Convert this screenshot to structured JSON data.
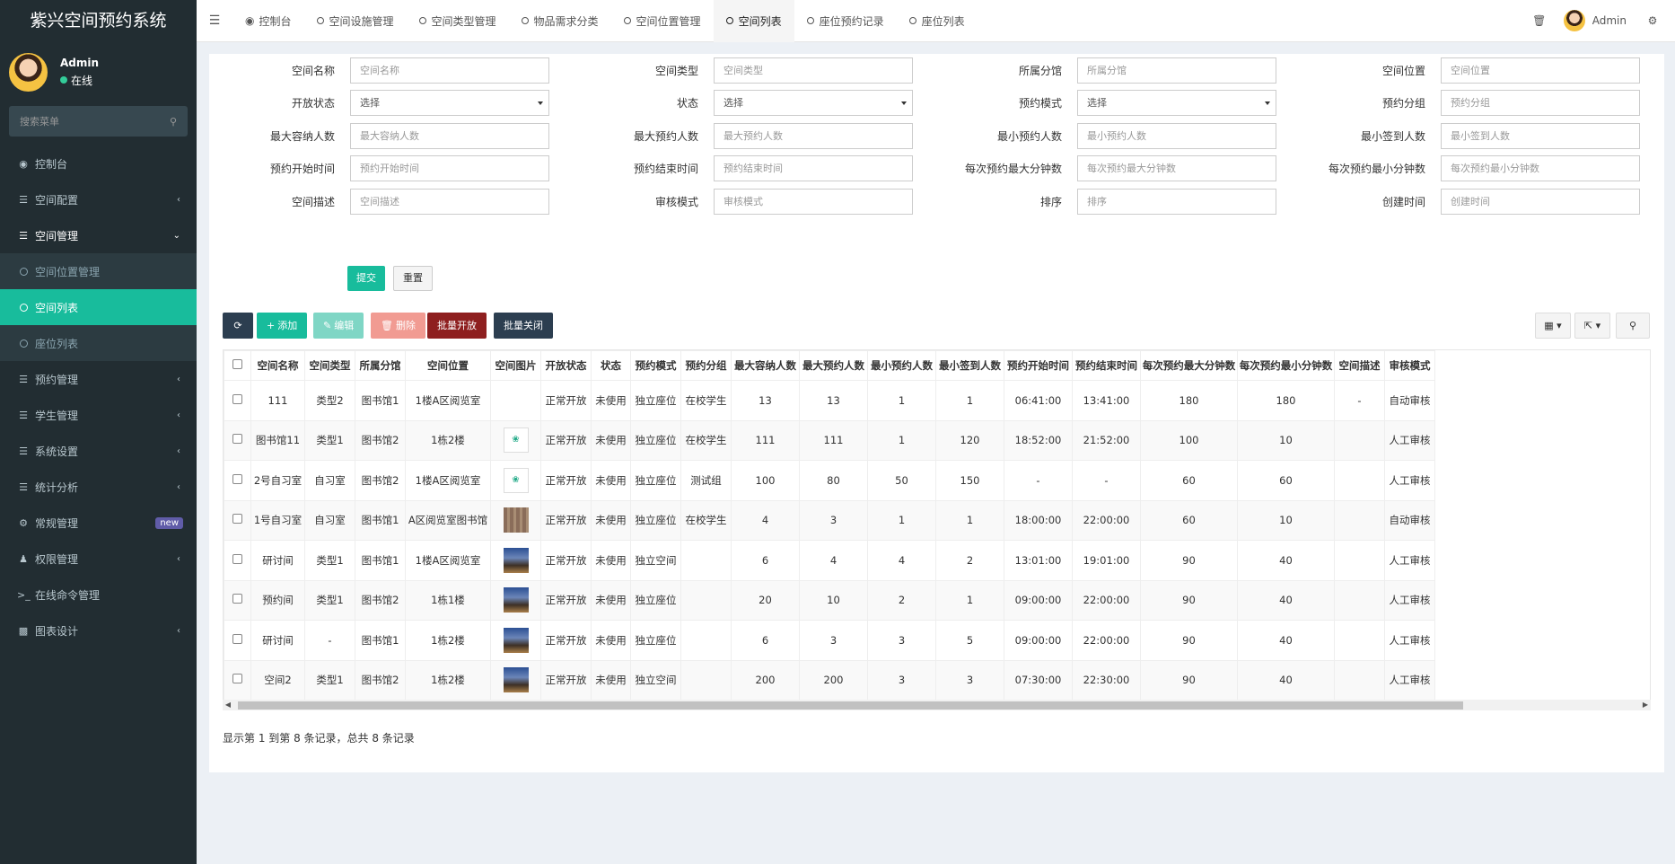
{
  "app": {
    "title": "紫兴空间预约系统"
  },
  "user": {
    "name": "Admin",
    "status": "在线"
  },
  "sidebar": {
    "search_placeholder": "搜索菜单",
    "items": [
      {
        "label": "控制台",
        "icon": "dashboard-icon"
      },
      {
        "label": "空间配置",
        "icon": "list-icon",
        "arrow": "‹"
      },
      {
        "label": "空间管理",
        "icon": "list-icon",
        "arrow": "⌄"
      },
      {
        "label": "预约管理",
        "icon": "list-icon",
        "arrow": "‹"
      },
      {
        "label": "学生管理",
        "icon": "list-icon",
        "arrow": "‹"
      },
      {
        "label": "系统设置",
        "icon": "list-icon",
        "arrow": "‹"
      },
      {
        "label": "统计分析",
        "icon": "list-icon",
        "arrow": "‹"
      },
      {
        "label": "常规管理",
        "icon": "cogs-icon",
        "badge": "new"
      },
      {
        "label": "权限管理",
        "icon": "group-icon",
        "arrow": "‹"
      },
      {
        "label": "在线命令管理",
        "icon": "terminal-icon"
      },
      {
        "label": "图表设计",
        "icon": "bar-chart-icon",
        "arrow": "‹"
      }
    ],
    "subitems": [
      {
        "label": "空间位置管理"
      },
      {
        "label": "空间列表"
      },
      {
        "label": "座位列表"
      }
    ]
  },
  "topnav": {
    "tabs": [
      "控制台",
      "空间设施管理",
      "空间类型管理",
      "物品需求分类",
      "空间位置管理",
      "空间列表",
      "座位预约记录",
      "座位列表"
    ],
    "user_name": "Admin"
  },
  "filters": {
    "rows": [
      [
        {
          "label": "空间名称",
          "placeholder": "空间名称"
        },
        {
          "label": "空间类型",
          "placeholder": "空间类型"
        },
        {
          "label": "所属分馆",
          "placeholder": "所属分馆"
        },
        {
          "label": "空间位置",
          "placeholder": "空间位置"
        }
      ],
      [
        {
          "label": "开放状态",
          "placeholder": "选择",
          "select": true
        },
        {
          "label": "状态",
          "placeholder": "选择",
          "select": true
        },
        {
          "label": "预约模式",
          "placeholder": "选择",
          "select": true
        },
        {
          "label": "预约分组",
          "placeholder": "预约分组"
        }
      ],
      [
        {
          "label": "最大容纳人数",
          "placeholder": "最大容纳人数"
        },
        {
          "label": "最大预约人数",
          "placeholder": "最大预约人数"
        },
        {
          "label": "最小预约人数",
          "placeholder": "最小预约人数"
        },
        {
          "label": "最小签到人数",
          "placeholder": "最小签到人数"
        }
      ],
      [
        {
          "label": "预约开始时间",
          "placeholder": "预约开始时间"
        },
        {
          "label": "预约结束时间",
          "placeholder": "预约结束时间"
        },
        {
          "label": "每次预约最大分钟数",
          "placeholder": "每次预约最大分钟数"
        },
        {
          "label": "每次预约最小分钟数",
          "placeholder": "每次预约最小分钟数"
        }
      ],
      [
        {
          "label": "空间描述",
          "placeholder": "空间描述"
        },
        {
          "label": "审核模式",
          "placeholder": "审核模式"
        },
        {
          "label": "排序",
          "placeholder": "排序"
        },
        {
          "label": "创建时间",
          "placeholder": "创建时间"
        }
      ]
    ],
    "submit_label": "提交",
    "reset_label": "重置"
  },
  "toolbar": {
    "add_label": "添加",
    "edit_label": "编辑",
    "delete_label": "删除",
    "batch_open_label": "批量开放",
    "batch_close_label": "批量关闭"
  },
  "table": {
    "columns": [
      "空间名称",
      "空间类型",
      "所属分馆",
      "空间位置",
      "空间图片",
      "开放状态",
      "状态",
      "预约模式",
      "预约分组",
      "最大容纳人数",
      "最大预约人数",
      "最小预约人数",
      "最小签到人数",
      "预约开始时间",
      "预约结束时间",
      "每次预约最大分钟数",
      "每次预约最小分钟数",
      "空间描述",
      "审核模式"
    ],
    "rows": [
      {
        "name": "111",
        "type": "类型2",
        "branch": "图书馆1",
        "location": "1楼A区阅览室",
        "image": "",
        "open": "正常开放",
        "status": "未使用",
        "mode": "独立座位",
        "group": "在校学生",
        "max_cap": "13",
        "max_res": "13",
        "min_res": "1",
        "min_sign": "1",
        "start": "06:41:00",
        "end": "13:41:00",
        "max_min": "180",
        "min_min": "180",
        "desc": "-",
        "audit": "自动审核"
      },
      {
        "name": "图书馆11",
        "type": "类型1",
        "branch": "图书馆2",
        "location": "1栋2楼",
        "image": "icon",
        "open": "正常开放",
        "status": "未使用",
        "mode": "独立座位",
        "group": "在校学生",
        "max_cap": "111",
        "max_res": "111",
        "min_res": "1",
        "min_sign": "120",
        "start": "18:52:00",
        "end": "21:52:00",
        "max_min": "100",
        "min_min": "10",
        "desc": "",
        "audit": "人工审核"
      },
      {
        "name": "2号自习室",
        "type": "自习室",
        "branch": "图书馆2",
        "location": "1楼A区阅览室",
        "image": "icon",
        "open": "正常开放",
        "status": "未使用",
        "mode": "独立座位",
        "group": "测试组",
        "max_cap": "100",
        "max_res": "80",
        "min_res": "50",
        "min_sign": "150",
        "start": "-",
        "end": "-",
        "max_min": "60",
        "min_min": "60",
        "desc": "",
        "audit": "人工审核"
      },
      {
        "name": "1号自习室",
        "type": "自习室",
        "branch": "图书馆1",
        "location": "A区阅览室图书馆",
        "image": "photo2",
        "open": "正常开放",
        "status": "未使用",
        "mode": "独立座位",
        "group": "在校学生",
        "max_cap": "4",
        "max_res": "3",
        "min_res": "1",
        "min_sign": "1",
        "start": "18:00:00",
        "end": "22:00:00",
        "max_min": "60",
        "min_min": "10",
        "desc": "",
        "audit": "自动审核"
      },
      {
        "name": "研讨间",
        "type": "类型1",
        "branch": "图书馆1",
        "location": "1楼A区阅览室",
        "image": "photo",
        "open": "正常开放",
        "status": "未使用",
        "mode": "独立空间",
        "group": "",
        "max_cap": "6",
        "max_res": "4",
        "min_res": "4",
        "min_sign": "2",
        "start": "13:01:00",
        "end": "19:01:00",
        "max_min": "90",
        "min_min": "40",
        "desc": "",
        "audit": "人工审核"
      },
      {
        "name": "预约间",
        "type": "类型1",
        "branch": "图书馆2",
        "location": "1栋1楼",
        "image": "photo",
        "open": "正常开放",
        "status": "未使用",
        "mode": "独立座位",
        "group": "",
        "max_cap": "20",
        "max_res": "10",
        "min_res": "2",
        "min_sign": "1",
        "start": "09:00:00",
        "end": "22:00:00",
        "max_min": "90",
        "min_min": "40",
        "desc": "",
        "audit": "人工审核"
      },
      {
        "name": "研讨间",
        "type": "-",
        "branch": "图书馆1",
        "location": "1栋2楼",
        "image": "photo",
        "open": "正常开放",
        "status": "未使用",
        "mode": "独立座位",
        "group": "",
        "max_cap": "6",
        "max_res": "3",
        "min_res": "3",
        "min_sign": "5",
        "start": "09:00:00",
        "end": "22:00:00",
        "max_min": "90",
        "min_min": "40",
        "desc": "",
        "audit": "人工审核"
      },
      {
        "name": "空间2",
        "type": "类型1",
        "branch": "图书馆2",
        "location": "1栋2楼",
        "image": "photo",
        "open": "正常开放",
        "status": "未使用",
        "mode": "独立空间",
        "group": "",
        "max_cap": "200",
        "max_res": "200",
        "min_res": "3",
        "min_sign": "3",
        "start": "07:30:00",
        "end": "22:30:00",
        "max_min": "90",
        "min_min": "40",
        "desc": "",
        "audit": "人工审核"
      }
    ]
  },
  "footer": {
    "summary": "显示第 1 到第 8 条记录，总共 8 条记录"
  },
  "colors": {
    "sidebar_bg": "#222d32",
    "accent": "#18bc9c",
    "danger_dark": "#8e1f1f",
    "primary_dark": "#2c3e50",
    "badge": "#605ca8"
  }
}
